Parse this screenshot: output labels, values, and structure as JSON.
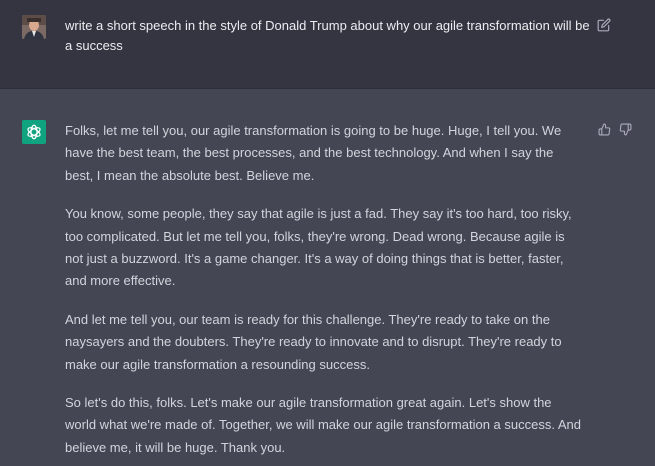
{
  "user_message": {
    "text": "write a short speech in the style of Donald Trump about why our agile transformation will be a success"
  },
  "assistant_message": {
    "paragraphs": [
      "Folks, let me tell you, our agile transformation is going to be huge. Huge, I tell you. We have the best team, the best processes, and the best technology. And when I say the best, I mean the absolute best. Believe me.",
      "You know, some people, they say that agile is just a fad. They say it's too hard, too risky, too complicated. But let me tell you, folks, they're wrong. Dead wrong. Because agile is not just a buzzword. It's a game changer. It's a way of doing things that is better, faster, and more effective.",
      "And let me tell you, our team is ready for this challenge. They're ready to take on the naysayers and the doubters. They're ready to innovate and to disrupt. They're ready to make our agile transformation a resounding success.",
      "So let's do this, folks. Let's make our agile transformation great again. Let's show the world what we're made of. Together, we will make our agile transformation a success. And believe me, it will be huge. Thank you."
    ]
  },
  "icons": {
    "user_avatar": "user-avatar-photo",
    "edit": "edit-icon",
    "assistant_avatar": "openai-logo-icon",
    "thumbs_up": "thumbs-up-icon",
    "thumbs_down": "thumbs-down-icon"
  },
  "colors": {
    "user_bg": "#343541",
    "assistant_bg": "#444654",
    "assistant_avatar_bg": "#10a37f",
    "text": "#d1d5db"
  }
}
